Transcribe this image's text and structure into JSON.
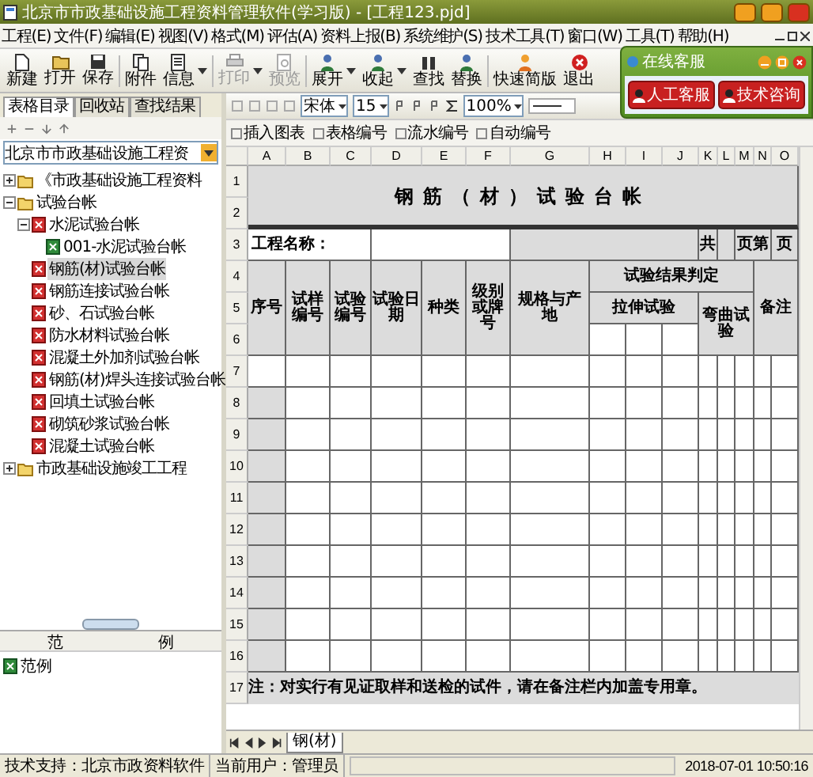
{
  "window": {
    "title": "北京市市政基础设施工程资料管理软件(学习版) - [工程123.pjd]"
  },
  "menu": [
    "工程(E)",
    "文件(F)",
    "编辑(E)",
    "视图(V)",
    "格式(M)",
    "评估(A)",
    "资料上报(B)",
    "系统维护(S)",
    "技术工具(T)",
    "窗口(W)",
    "工具(T)",
    "帮助(H)"
  ],
  "toolbar": [
    {
      "label": "新建",
      "disabled": false,
      "dropdown": false
    },
    {
      "label": "打开",
      "disabled": false,
      "dropdown": false
    },
    {
      "label": "保存",
      "disabled": false,
      "dropdown": false
    },
    {
      "label": "附件",
      "disabled": false,
      "dropdown": false
    },
    {
      "label": "信息",
      "disabled": false,
      "dropdown": true
    },
    {
      "label": "打印",
      "disabled": true,
      "dropdown": true
    },
    {
      "label": "预览",
      "disabled": true,
      "dropdown": false
    },
    {
      "label": "展开",
      "disabled": false,
      "dropdown": true
    },
    {
      "label": "收起",
      "disabled": false,
      "dropdown": true
    },
    {
      "label": "查找",
      "disabled": false,
      "dropdown": false
    },
    {
      "label": "替换",
      "disabled": false,
      "dropdown": false
    },
    {
      "label": "快速简版",
      "disabled": false,
      "dropdown": false
    },
    {
      "label": "退出",
      "disabled": false,
      "dropdown": false
    }
  ],
  "service_panel": {
    "title": "在线客服",
    "buttons": [
      "人工客服",
      "技术咨询"
    ]
  },
  "left_tabs": [
    {
      "label": "表格目录",
      "selected": true
    },
    {
      "label": "回收站",
      "selected": false
    },
    {
      "label": "查找结果",
      "selected": false
    }
  ],
  "standard_select": {
    "value": "北京市市政基础设施工程资"
  },
  "tree": [
    {
      "label": "《市政基础设施工程资料",
      "kind": "folder",
      "expanded": false,
      "selected": false
    },
    {
      "label": "试验台帐",
      "kind": "folder",
      "expanded": true,
      "selected": false,
      "children": [
        {
          "label": "水泥试验台帐",
          "kind": "ledger",
          "expanded": true,
          "selected": false,
          "children": [
            {
              "label": "001-水泥试验台帐",
              "kind": "sheet",
              "selected": false
            }
          ]
        },
        {
          "label": "钢筋(材)试验台帐",
          "kind": "ledger",
          "selected": true
        },
        {
          "label": "钢筋连接试验台帐",
          "kind": "ledger",
          "selected": false
        },
        {
          "label": "砂、石试验台帐",
          "kind": "ledger",
          "selected": false
        },
        {
          "label": "防水材料试验台帐",
          "kind": "ledger",
          "selected": false
        },
        {
          "label": "混凝土外加剂试验台帐",
          "kind": "ledger",
          "selected": false
        },
        {
          "label": "钢筋(材)焊头连接试验台帐",
          "kind": "ledger",
          "selected": false
        },
        {
          "label": "回填土试验台帐",
          "kind": "ledger",
          "selected": false
        },
        {
          "label": "砌筑砂浆试验台帐",
          "kind": "ledger",
          "selected": false
        },
        {
          "label": "混凝土试验台帐",
          "kind": "ledger",
          "selected": false
        }
      ]
    },
    {
      "label": "市政基础设施竣工工程",
      "kind": "folder",
      "expanded": false,
      "selected": false
    }
  ],
  "example_panel": {
    "columns": [
      "范",
      "例"
    ],
    "items": [
      {
        "label": "范例",
        "kind": "sheet"
      }
    ]
  },
  "format_toolbar": {
    "font": "宋体",
    "size": "15",
    "zoom": "100%"
  },
  "sheet_toolbar": [
    "插入图表",
    "表格编号",
    "流水编号",
    "自动编号"
  ],
  "sheet": {
    "columns": [
      "A",
      "B",
      "C",
      "D",
      "E",
      "F",
      "G",
      "H",
      "I",
      "J",
      "K",
      "L",
      "M",
      "N",
      "O"
    ],
    "rows": [
      "1",
      "2",
      "3",
      "4",
      "5",
      "6",
      "7",
      "8",
      "9",
      "10",
      "11",
      "12",
      "13",
      "14",
      "15",
      "16",
      "17"
    ],
    "title": "钢筋（材）试验台帐",
    "project_label": "工程名称：",
    "total_label": "共",
    "page_label": "页第",
    "page_suffix": "页",
    "headers": [
      "序号",
      "试样编号",
      "试验编号",
      "试验日期",
      "种类",
      "级别或牌号",
      "规格与产地",
      "试验结果判定",
      "拉伸试验",
      "弯曲试验",
      "备注"
    ],
    "note": "注：对实行有见证取样和送检的试件，请在备注栏内加盖专用章。"
  },
  "sheet_tabs": [
    {
      "label": "钢(材)",
      "selected": true
    }
  ],
  "status_bar": {
    "left": "技术支持：北京市政资料软件",
    "user": "当前用户：管理员",
    "time": "2018-07-01 10:50:16"
  }
}
